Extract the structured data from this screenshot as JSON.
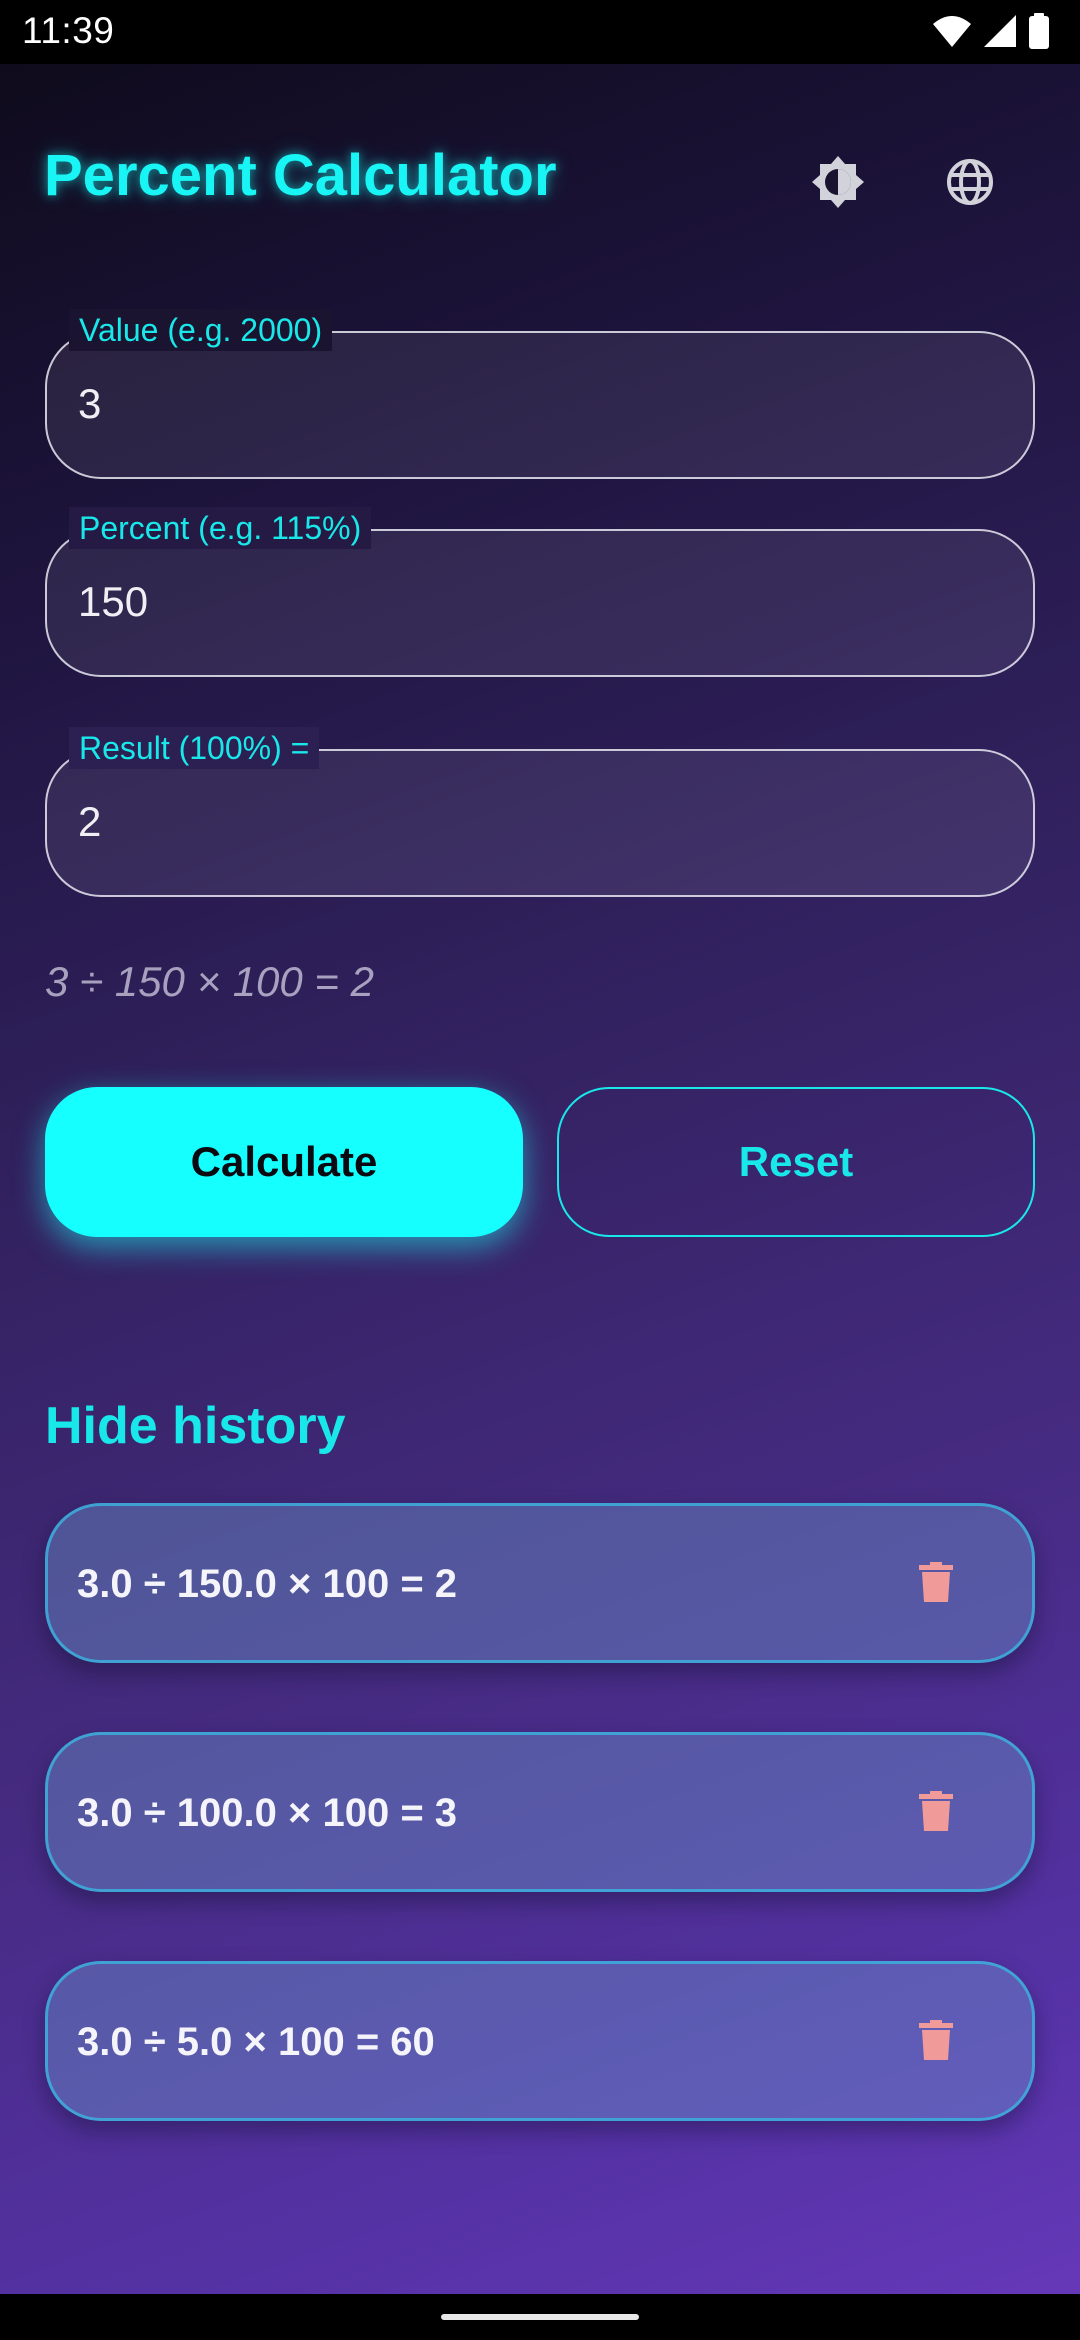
{
  "status_bar": {
    "time": "11:39",
    "icons": [
      "wifi-icon",
      "cellular-signal-icon",
      "battery-icon"
    ]
  },
  "header": {
    "title": "Percent Calculator",
    "icons": [
      "theme-toggle-icon",
      "language-globe-icon"
    ]
  },
  "form": {
    "value_field": {
      "label": "Value (e.g. 2000)",
      "value": "3"
    },
    "percent_field": {
      "label": "Percent (e.g. 115%)",
      "value": "150"
    },
    "result_field": {
      "label": "Result (100%) =",
      "value": "2"
    },
    "formula": "3 ÷ 150 × 100 = 2"
  },
  "buttons": {
    "calculate_label": "Calculate",
    "reset_label": "Reset"
  },
  "history": {
    "toggle_label": "Hide history",
    "items": [
      {
        "text": "3.0 ÷ 150.0 × 100 = 2",
        "icon": "delete-icon"
      },
      {
        "text": "3.0 ÷ 100.0 × 100 = 3",
        "icon": "delete-icon"
      },
      {
        "text": "3.0 ÷ 5.0 × 100 = 60",
        "icon": "delete-icon"
      }
    ]
  },
  "colors": {
    "accent": "#19f5f5",
    "delete": "#f09a9a",
    "background_top": "#0f0b1c",
    "background_bottom": "#6538b8"
  }
}
